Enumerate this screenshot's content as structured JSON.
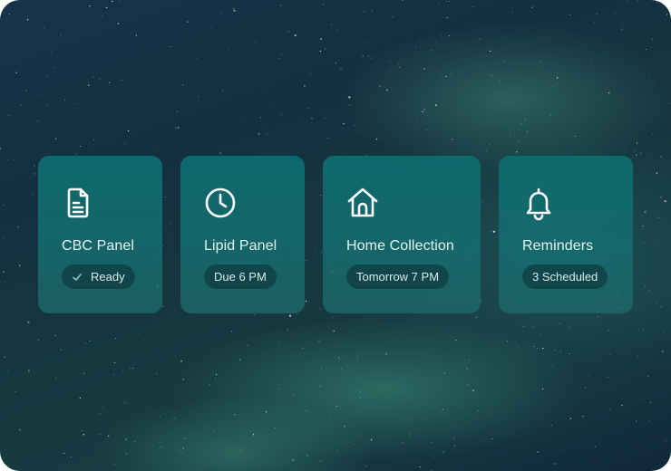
{
  "cards": [
    {
      "title": "CBC Panel",
      "icon": "document-icon",
      "badge": "Ready",
      "badge_icon": "check-icon"
    },
    {
      "title": "Lipid Panel",
      "icon": "clock-icon",
      "badge": "Due 6 PM"
    },
    {
      "title": "Home Collection",
      "icon": "home-icon",
      "badge": "Tomorrow 7 PM"
    },
    {
      "title": "Reminders",
      "icon": "bell-icon",
      "badge": "3 Scheduled"
    }
  ],
  "colors": {
    "card": "#0e6c70",
    "badge": "#0e3a3e",
    "text": "#e4f3f1",
    "check": "#7fd0c2"
  }
}
